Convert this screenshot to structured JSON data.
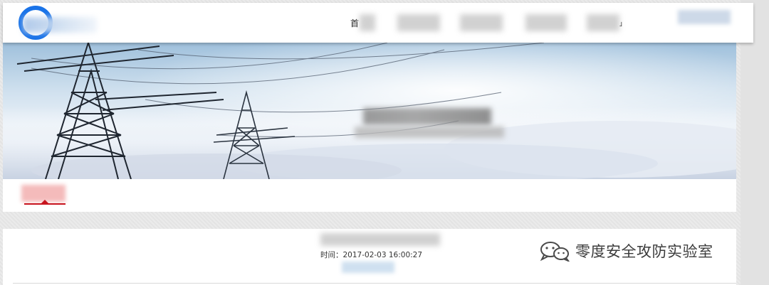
{
  "header": {
    "nav_first_char": "首",
    "nav_items": [
      "",
      "",
      "",
      ""
    ],
    "nav_last_mark": "」"
  },
  "article": {
    "time_label": "时间：",
    "time_value": "2017-02-03 16:00:27"
  },
  "watermark": {
    "text": "零度安全攻防实验室",
    "icon": "wechat-icon"
  },
  "colors": {
    "accent": "#c8141e",
    "logo_blue": "#1a73e8"
  }
}
